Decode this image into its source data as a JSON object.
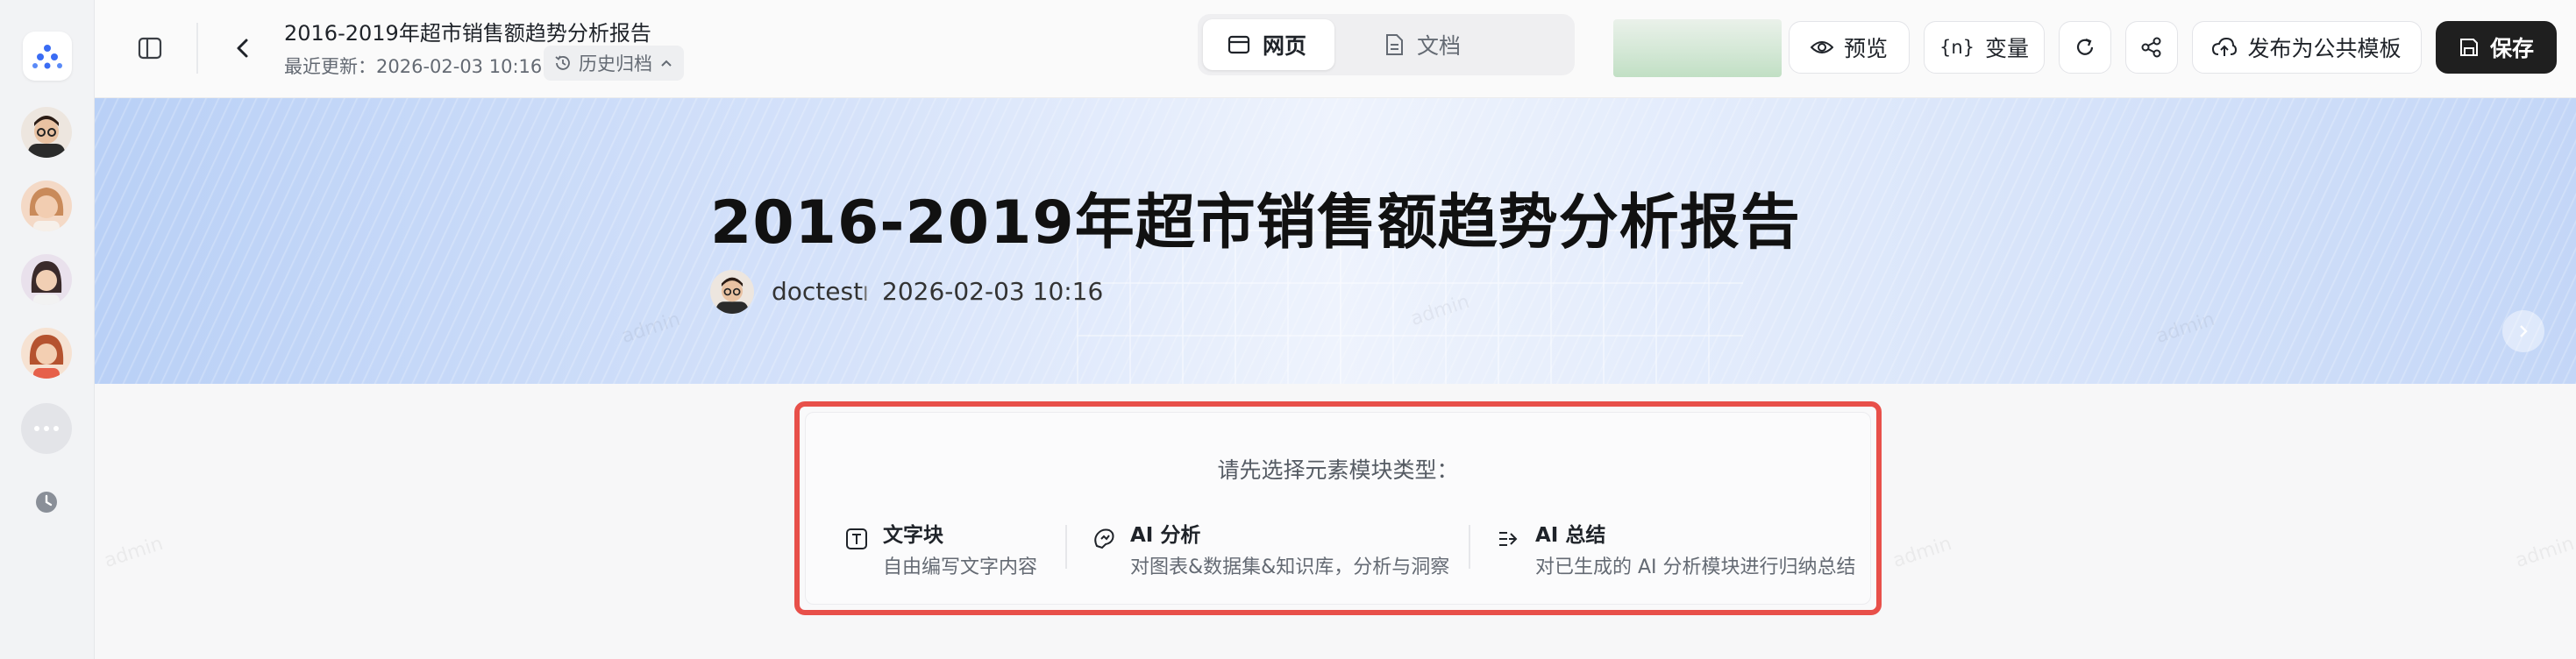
{
  "rail": {
    "logo_icon": "brand-logo-icon",
    "avatars": [
      "avatar-1",
      "avatar-2",
      "avatar-3",
      "avatar-4"
    ],
    "more_icon": "more-dots-icon",
    "history_icon": "clock-icon"
  },
  "header": {
    "title": "2016-2019年超市销售额趋势分析报告",
    "last_update": "最近更新：2026-02-03 10:16",
    "history_label": "历史归档",
    "tabs": [
      {
        "label": "网页",
        "icon": "webpage-icon",
        "active": true
      },
      {
        "label": "文档",
        "icon": "document-icon",
        "active": false
      }
    ],
    "buttons": {
      "preview": "预览",
      "variables": "变量",
      "variables_glyph": "{n}",
      "publish": "发布为公共模板",
      "save": "保存"
    }
  },
  "banner": {
    "title": "2016-2019年超市销售额趋势分析报告",
    "author": "doctest",
    "separator": "I",
    "date": "2026-02-03 10:16"
  },
  "picker": {
    "prompt": "请先选择元素模块类型：",
    "options": [
      {
        "title": "文字块",
        "desc": "自由编写文字内容",
        "icon": "text-block-icon"
      },
      {
        "title": "AI 分析",
        "desc": "对图表&数据集&知识库，分析与洞察",
        "icon": "ai-analysis-icon"
      },
      {
        "title": "AI 总结",
        "desc": "对已生成的 AI 分析模块进行归纳总结",
        "icon": "ai-summary-icon"
      }
    ]
  },
  "watermark": "admin",
  "colors": {
    "highlight_border": "#e8504a",
    "save_button": "#1f1f1f",
    "brand": "#3a6cf4"
  }
}
